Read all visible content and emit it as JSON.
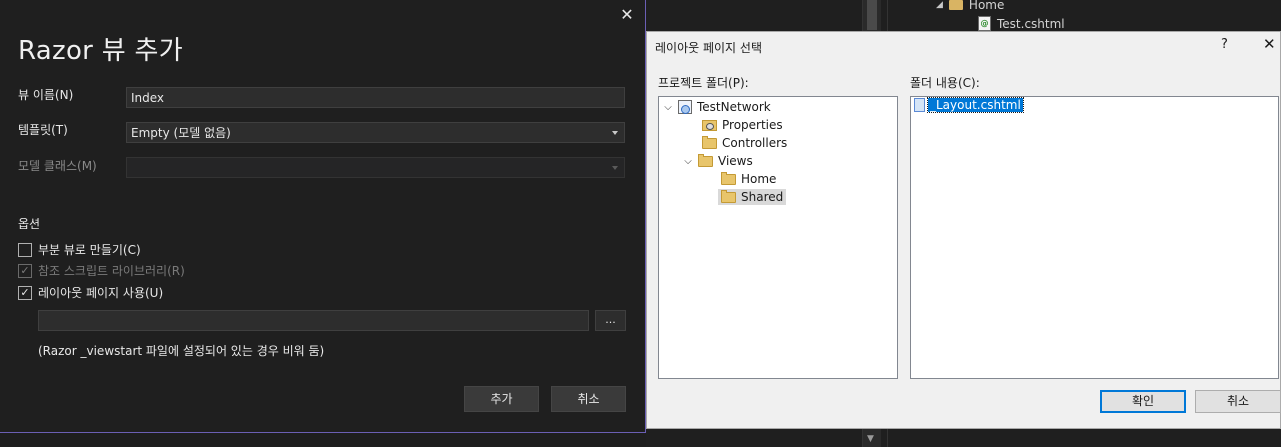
{
  "background": {
    "tree": [
      {
        "label": "Home",
        "kind": "folder",
        "expanded": true
      },
      {
        "label": "Test.cshtml",
        "kind": "file",
        "icon": "cshtml-file-icon"
      }
    ]
  },
  "add_view_dialog": {
    "title": "Razor 뷰 추가",
    "close": "✕",
    "view_name": {
      "label": "뷰 이름(N)",
      "value": "Index"
    },
    "template": {
      "label": "템플릿(T)",
      "value": "Empty (모델 없음)"
    },
    "model_class": {
      "label": "모델 클래스(M)",
      "value": ""
    },
    "options_title": "옵션",
    "options": [
      {
        "label": "부분 뷰로 만들기(C)",
        "checked": false,
        "enabled": true
      },
      {
        "label": "참조 스크립트 라이브러리(R)",
        "checked": true,
        "enabled": false
      },
      {
        "label": "레이아웃 페이지 사용(U)",
        "checked": true,
        "enabled": true
      }
    ],
    "layout_path": "",
    "browse": "...",
    "hint": "(Razor _viewstart 파일에 설정되어 있는 경우 비워 둠)",
    "add_button": "추가",
    "cancel_button": "취소"
  },
  "layout_dialog": {
    "title": "레이아웃 페이지 선택",
    "help": "?",
    "close": "✕",
    "project_folders_label": "프로젝트 폴더(P):",
    "folder_contents_label": "폴더 내용(C):",
    "tree": [
      {
        "label": "TestNetwork",
        "icon": "project-icon",
        "expanded": true
      },
      {
        "label": "Properties",
        "icon": "properties-folder-icon"
      },
      {
        "label": "Controllers",
        "icon": "folder-icon"
      },
      {
        "label": "Views",
        "icon": "folder-icon",
        "expanded": true
      },
      {
        "label": "Home",
        "icon": "folder-icon"
      },
      {
        "label": "Shared",
        "icon": "folder-icon",
        "selected": true
      }
    ],
    "files": [
      {
        "label": "_Layout.cshtml",
        "selected": true
      }
    ],
    "ok_button": "확인",
    "cancel_button": "취소"
  },
  "colors": {
    "dark_bg": "#1f1f1f",
    "accent_border": "#6b5fb5",
    "selection_blue": "#0078d7",
    "light_dialog_bg": "#f0f0f0"
  }
}
